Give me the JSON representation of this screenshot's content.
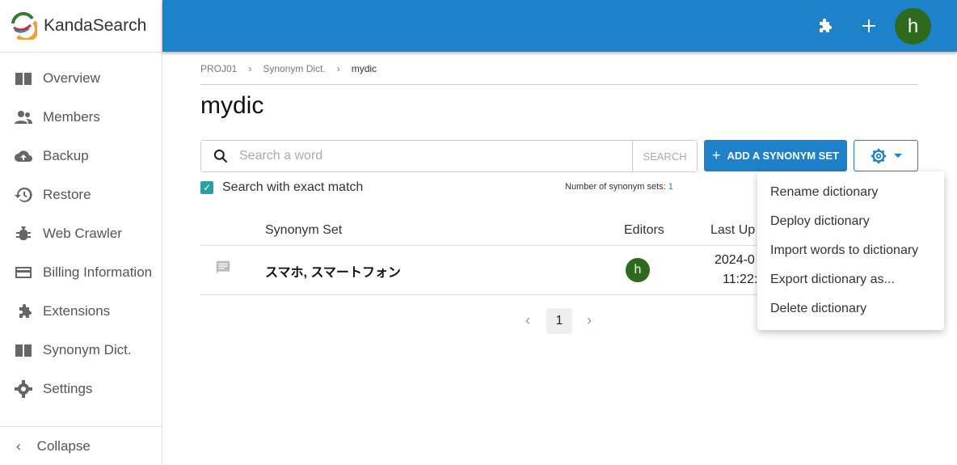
{
  "app": {
    "name": "KandaSearch",
    "user_initial": "h"
  },
  "sidebar": {
    "items": [
      {
        "label": "Overview",
        "icon": "book-icon"
      },
      {
        "label": "Members",
        "icon": "people-icon"
      },
      {
        "label": "Backup",
        "icon": "cloud-upload-icon"
      },
      {
        "label": "Restore",
        "icon": "history-icon"
      },
      {
        "label": "Web Crawler",
        "icon": "bug-icon"
      },
      {
        "label": "Billing Information",
        "icon": "credit-card-icon"
      },
      {
        "label": "Extensions",
        "icon": "puzzle-icon"
      },
      {
        "label": "Synonym Dict.",
        "icon": "book-icon"
      },
      {
        "label": "Settings",
        "icon": "gear-icon"
      }
    ],
    "collapse": "Collapse"
  },
  "breadcrumb": [
    "PROJ01",
    "Synonym Dict.",
    "mydic"
  ],
  "page_title": "mydic",
  "search": {
    "placeholder": "Search a word",
    "button": "SEARCH"
  },
  "add_button": "ADD A SYNONYM SET",
  "exact_match": {
    "label": "Search with exact match",
    "checked": true
  },
  "count": {
    "label": "Number of synonym sets:",
    "value": "1"
  },
  "table": {
    "headers": [
      "Synonym Set",
      "Editors",
      "Last Up"
    ],
    "rows": [
      {
        "synonyms": "スマホ, スマートフォン",
        "editor": "h",
        "date": "2024-0",
        "time": "11:22:"
      }
    ]
  },
  "pagination": {
    "current": "1"
  },
  "menu": [
    "Rename dictionary",
    "Deploy dictionary",
    "Import words to dictionary",
    "Export dictionary as...",
    "Delete dictionary"
  ],
  "colors": {
    "primary": "#1e82cb",
    "avatar": "#2e6a1e",
    "checkbox": "#2aa0a0"
  }
}
